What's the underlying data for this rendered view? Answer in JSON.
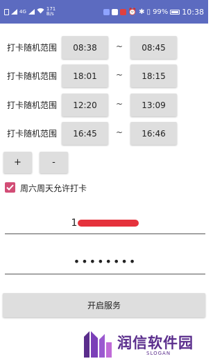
{
  "status_bar": {
    "left_text": "4G",
    "speed_value": "171",
    "speed_unit": "B/s",
    "battery_percent": "99%",
    "time": "10:38"
  },
  "rows": [
    {
      "label": "打卡随机范围",
      "start": "08:38",
      "separator": "~",
      "end": "08:45"
    },
    {
      "label": "打卡随机范围",
      "start": "18:01",
      "separator": "~",
      "end": "18:15"
    },
    {
      "label": "打卡随机范围",
      "start": "12:20",
      "separator": "~",
      "end": "13:09"
    },
    {
      "label": "打卡随机范围",
      "start": "16:45",
      "separator": "~",
      "end": "16:46"
    }
  ],
  "buttons": {
    "add": "+",
    "remove": "-",
    "start": "开启服务"
  },
  "weekend_checkbox": {
    "label": "周六周天允许打卡",
    "checked": true
  },
  "account_field": {
    "visible_prefix": "1"
  },
  "password_field": {
    "masked": "••••••••"
  },
  "watermark": {
    "name": "润信软件园",
    "slogan": "SLOGAN"
  },
  "colors": {
    "status_bar": "#5c6bc0",
    "checkbox_accent": "#d24d76",
    "button_bg": "#dedede",
    "watermark": "#5a2d8c"
  }
}
